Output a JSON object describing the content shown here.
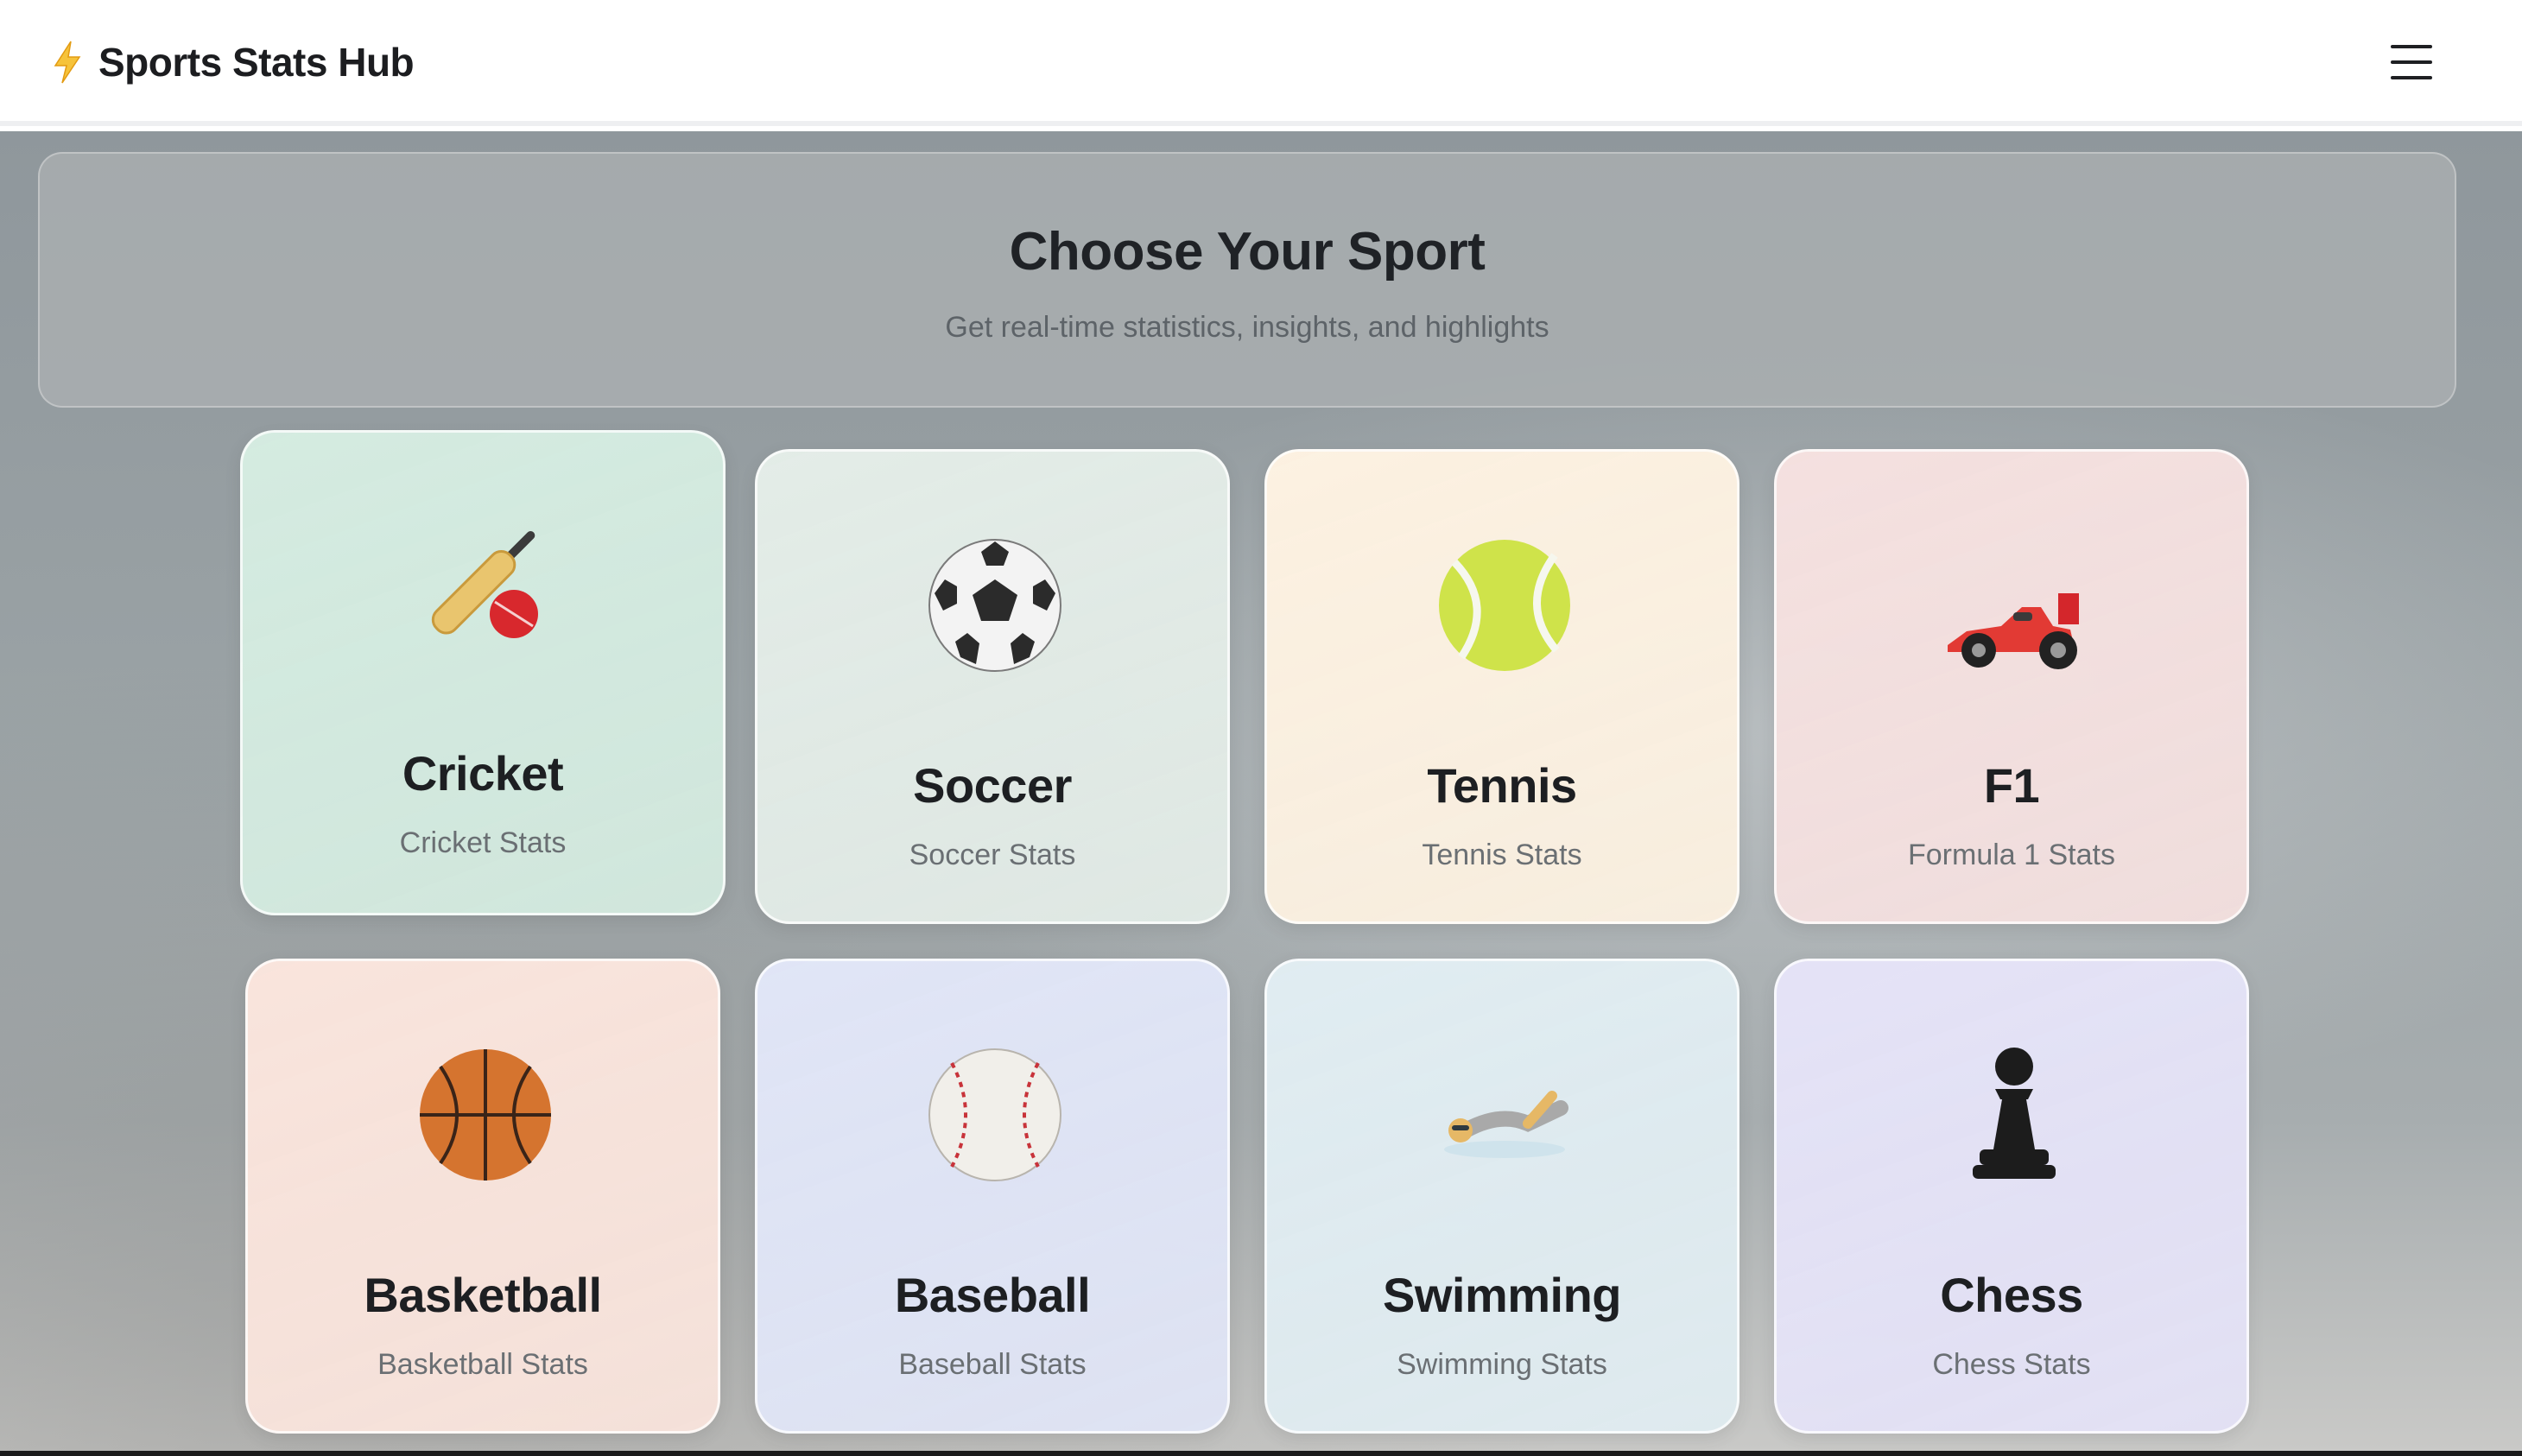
{
  "header": {
    "brand_icon": "lightning-bolt-icon",
    "brand_name": "Sports Stats Hub",
    "menu_icon": "hamburger-menu-icon"
  },
  "hero": {
    "title": "Choose Your Sport",
    "subtitle": "Get real-time statistics, insights, and highlights"
  },
  "sports": [
    {
      "name": "Cricket",
      "subtitle": "Cricket Stats",
      "icon": "cricket-bat-ball-icon",
      "color": "#d4ebe0"
    },
    {
      "name": "Soccer",
      "subtitle": "Soccer Stats",
      "icon": "soccer-ball-icon",
      "color": "#e3ece7"
    },
    {
      "name": "Tennis",
      "subtitle": "Tennis Stats",
      "icon": "tennis-ball-icon",
      "color": "#fcf1e1"
    },
    {
      "name": "F1",
      "subtitle": "Formula 1 Stats",
      "icon": "racing-car-icon",
      "color": "#f4e0df"
    },
    {
      "name": "Basketball",
      "subtitle": "Basketball Stats",
      "icon": "basketball-icon",
      "color": "#f9e4dc"
    },
    {
      "name": "Baseball",
      "subtitle": "Baseball Stats",
      "icon": "baseball-icon",
      "color": "#e0e5f6"
    },
    {
      "name": "Swimming",
      "subtitle": "Swimming Stats",
      "icon": "swimmer-icon",
      "color": "#e0ecf1"
    },
    {
      "name": "Chess",
      "subtitle": "Chess Stats",
      "icon": "chess-pawn-icon",
      "color": "#e4e2f6"
    }
  ]
}
